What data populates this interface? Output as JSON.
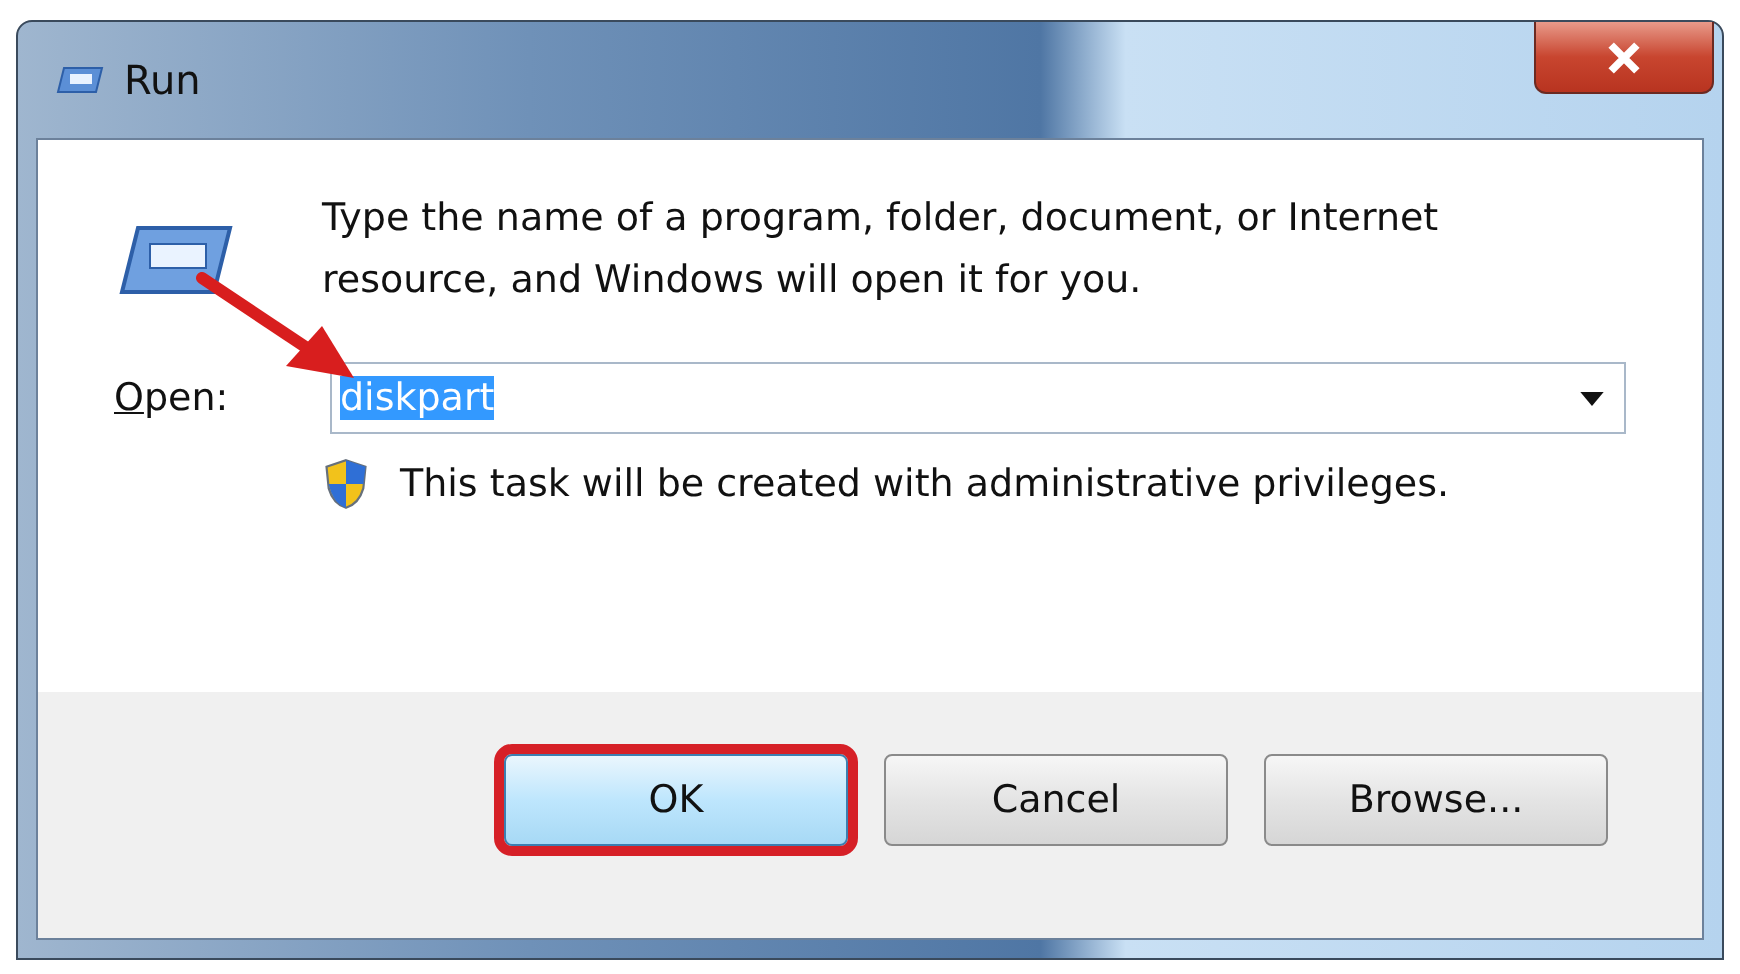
{
  "window": {
    "title": "Run"
  },
  "message": "Type the name of a program, folder, document, or Internet resource, and Windows will open it for you.",
  "open_field": {
    "label": "Open:",
    "value": "diskpart",
    "text_selected": true,
    "annotated": true
  },
  "admin_note": "This task will be created with administrative privileges.",
  "buttons": [
    {
      "label": "OK",
      "default": true,
      "highlighted": true
    },
    {
      "label": "Cancel",
      "default": false,
      "highlighted": false
    },
    {
      "label": "Browse...",
      "default": false,
      "highlighted": false
    }
  ]
}
